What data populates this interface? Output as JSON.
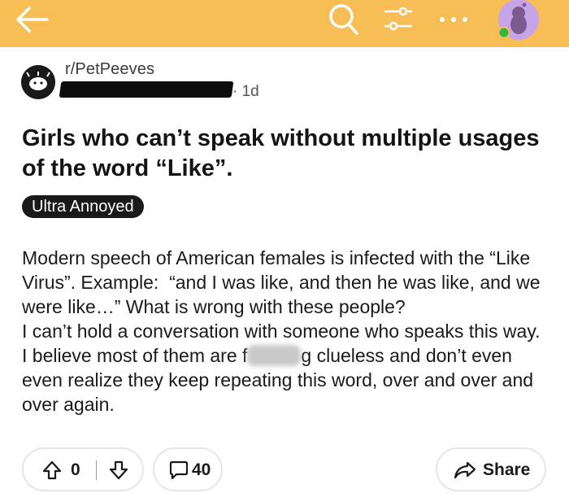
{
  "colors": {
    "topbar": "#f6be55",
    "online_dot": "#2fb847",
    "avatar": "#c7a3e8"
  },
  "topbar": {
    "icons": [
      "back-arrow-icon",
      "search-icon",
      "filter-icon",
      "more-icon",
      "avatar"
    ]
  },
  "post": {
    "subreddit": "r/PetPeeves",
    "time_separator": "·",
    "age": "1d",
    "title": "Girls who can’t speak without multiple usages of the word “Like”.",
    "flair": "Ultra Annoyed",
    "body_part1": "Modern speech of American females is infected with the “Like Virus”. Example:  “and I was like, and then he was like, and we were like…” What is wrong with these people?\nI can’t hold a conversation with someone who speaks this way. I believe most of them are f",
    "body_part2": "g clueless and don’t even even realize they keep repeating this word, over and over and over again."
  },
  "actions": {
    "votes": "0",
    "comments": "40",
    "share": "Share"
  }
}
